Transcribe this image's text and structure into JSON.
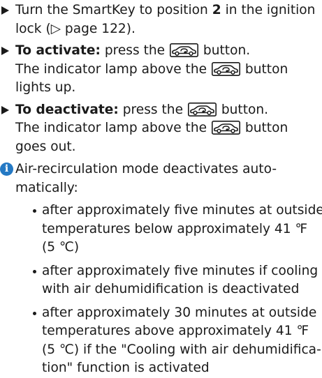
{
  "steps": [
    {
      "line1_pre": "Turn the SmartKey to position ",
      "position": "2",
      "line1_post": " in the ignition",
      "line2": "lock (▷ page 122)."
    },
    {
      "label": "To activate:",
      "action_pre": " press the ",
      "action_post": " button.",
      "result_pre": "The indicator lamp above the ",
      "result_post": " button",
      "result_end": "lights up."
    },
    {
      "label": "To deactivate:",
      "action_pre": " press the ",
      "action_post": " button.",
      "result_pre": "The indicator lamp above the ",
      "result_post": " button",
      "result_end": "goes out."
    }
  ],
  "button_icon": "air-recirculation-button-icon",
  "info_icon": "i",
  "note": {
    "line1": "Air-recirculation mode deactivates auto-",
    "line2": "matically:",
    "bullets": [
      [
        "after approximately five minutes at outside",
        "temperatures below approximately 41 ℉",
        "(5 ℃)"
      ],
      [
        "after approximately five minutes if cooling",
        "with air dehumidification is deactivated"
      ],
      [
        "after approximately 30 minutes at outside",
        "temperatures above approximately 41 ℉",
        "(5 ℃) if the \"Cooling with air dehumidifica-",
        "tion\" function is activated"
      ]
    ]
  },
  "colors": {
    "text": "#1a1a1a",
    "info_icon_bg": "#2479c4"
  }
}
